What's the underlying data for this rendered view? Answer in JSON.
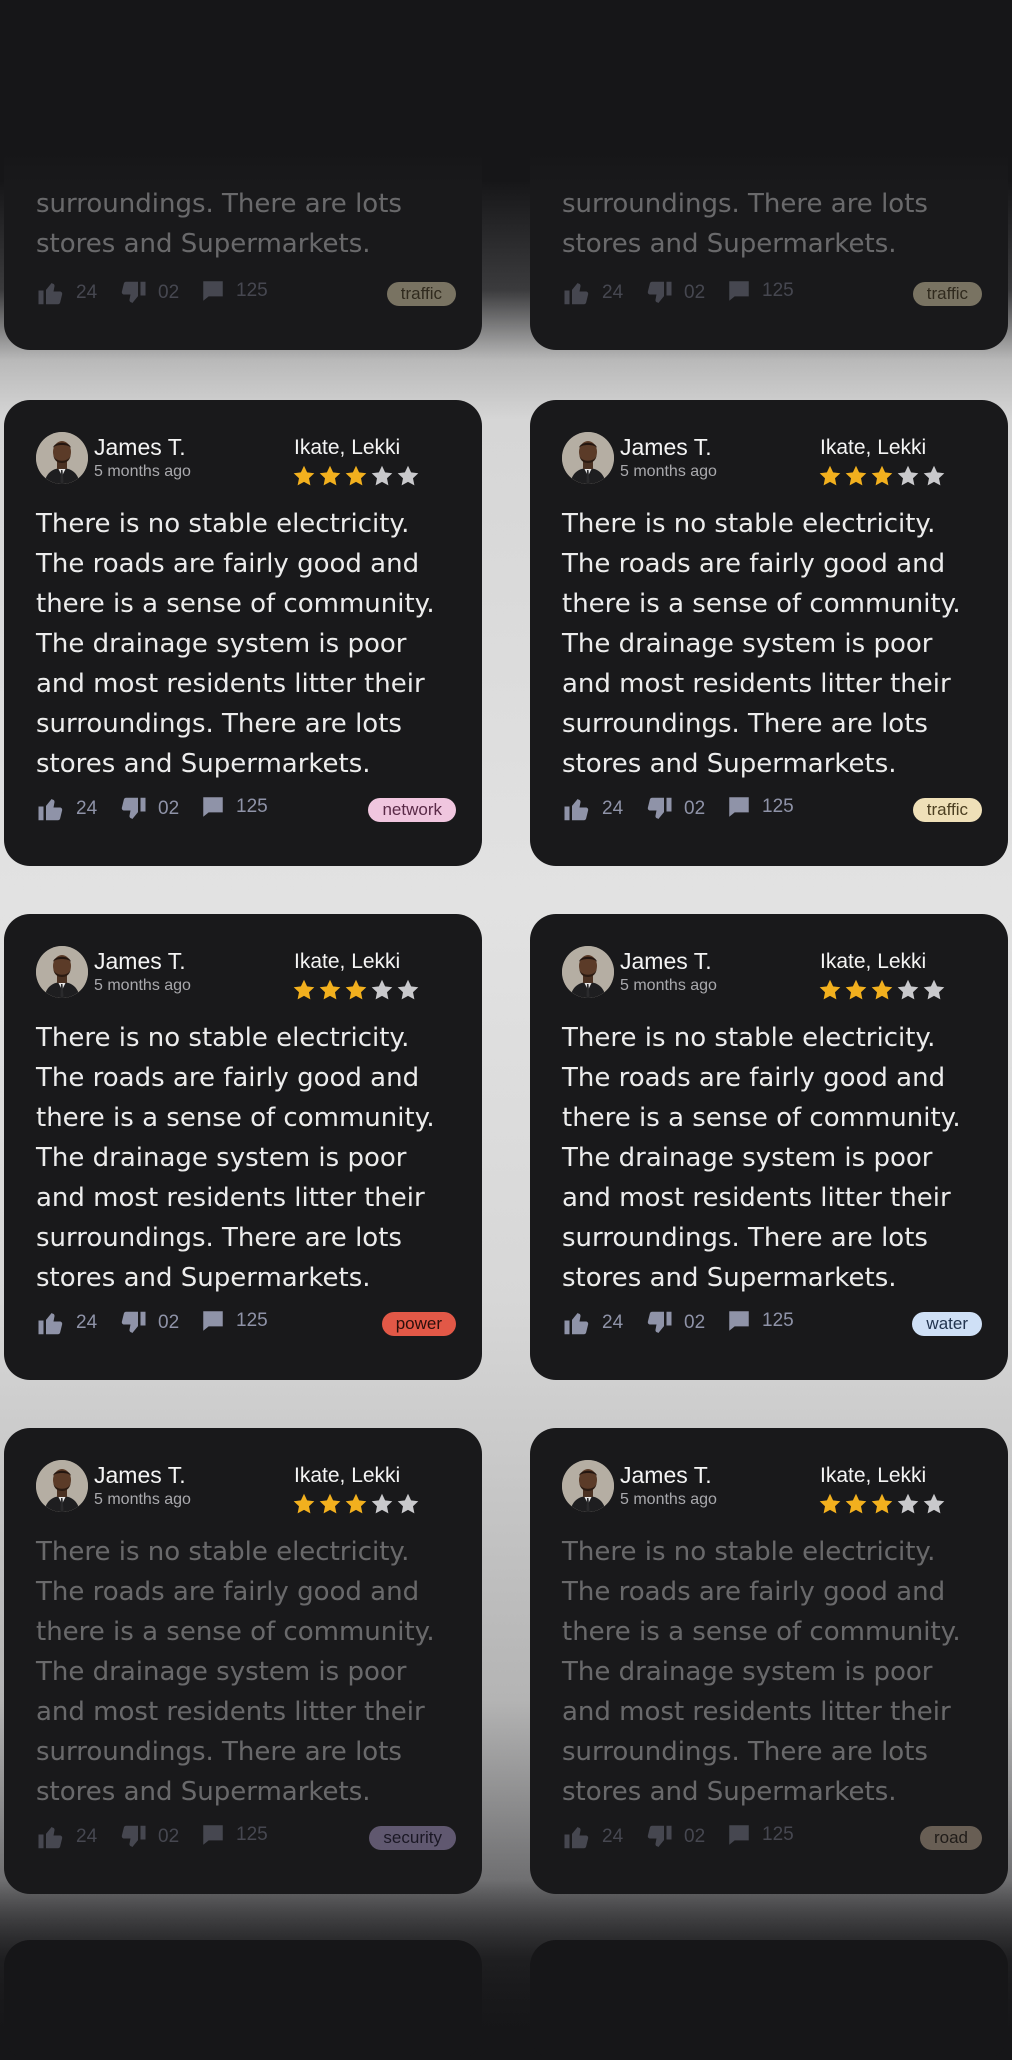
{
  "partial_top": [
    {
      "text_lines": [
        "surroundings. There are lots",
        "stores and Supermarkets."
      ],
      "likes": "24",
      "dislikes": "02",
      "comments": "125",
      "tag": "traffic"
    },
    {
      "text_lines": [
        "surroundings. There are lots",
        "stores and Supermarkets."
      ],
      "likes": "24",
      "dislikes": "02",
      "comments": "125",
      "tag": "traffic"
    }
  ],
  "reviews": [
    {
      "name": "James T.",
      "time": "5 months ago",
      "location": "Ikate, Lekki",
      "rating": 3,
      "max_rating": 5,
      "text": "There is no stable electricity. The roads are fairly good and there is a sense of community. The drainage system is poor and most residents litter their surroundings. There are lots stores and Supermarkets.",
      "likes": "24",
      "dislikes": "02",
      "comments": "125",
      "tag": "network",
      "tag_bg": "#f0c6df",
      "tag_fg": "#5a2a48"
    },
    {
      "name": "James T.",
      "time": "5 months ago",
      "location": "Ikate, Lekki",
      "rating": 3,
      "max_rating": 5,
      "text": "There is no stable electricity. The roads are fairly good and there is a sense of community. The drainage system is poor and most residents litter their surroundings. There are lots stores and Supermarkets.",
      "likes": "24",
      "dislikes": "02",
      "comments": "125",
      "tag": "traffic",
      "tag_bg": "#efe0b8",
      "tag_fg": "#4d4022"
    },
    {
      "name": "James T.",
      "time": "5 months ago",
      "location": "Ikate, Lekki",
      "rating": 3,
      "max_rating": 5,
      "text": "There is no stable electricity. The roads are fairly good and there is a sense of community. The drainage system is poor and most residents litter their surroundings. There are lots stores and Supermarkets.",
      "likes": "24",
      "dislikes": "02",
      "comments": "125",
      "tag": "power",
      "tag_bg": "#e25847",
      "tag_fg": "#2a0f0b"
    },
    {
      "name": "James T.",
      "time": "5 months ago",
      "location": "Ikate, Lekki",
      "rating": 3,
      "max_rating": 5,
      "text": "There is no stable electricity. The roads are fairly good and there is a sense of community. The drainage system is poor and most residents litter their surroundings. There are lots stores and Supermarkets.",
      "likes": "24",
      "dislikes": "02",
      "comments": "125",
      "tag": "water",
      "tag_bg": "#cfe0f6",
      "tag_fg": "#22344f"
    },
    {
      "name": "James T.",
      "time": "5 months ago",
      "location": "Ikate, Lekki",
      "rating": 3,
      "max_rating": 5,
      "text": "There is no stable electricity. The roads are fairly good and there is a sense of community. The drainage system is poor and most residents litter their surroundings. There are lots stores and Supermarkets.",
      "likes": "24",
      "dislikes": "02",
      "comments": "125",
      "tag": "security",
      "tag_bg": "#b7a6d8",
      "tag_fg": "#1d1630"
    },
    {
      "name": "James T.",
      "time": "5 months ago",
      "location": "Ikate, Lekki",
      "rating": 3,
      "max_rating": 5,
      "text": "There is no stable electricity. The roads are fairly good and there is a sense of community. The drainage system is poor and most residents litter their surroundings. There are lots stores and Supermarkets.",
      "likes": "24",
      "dislikes": "02",
      "comments": "125",
      "tag": "road",
      "tag_bg": "#c9b39a",
      "tag_fg": "#2a2017"
    }
  ],
  "colors": {
    "star_filled": "#f2b01e",
    "star_empty": "#c9c9cc",
    "card_bg": "#19191b"
  },
  "icons": {
    "like": "thumbs-up-icon",
    "dislike": "thumbs-down-icon",
    "comment": "comment-icon",
    "star": "star-icon"
  }
}
